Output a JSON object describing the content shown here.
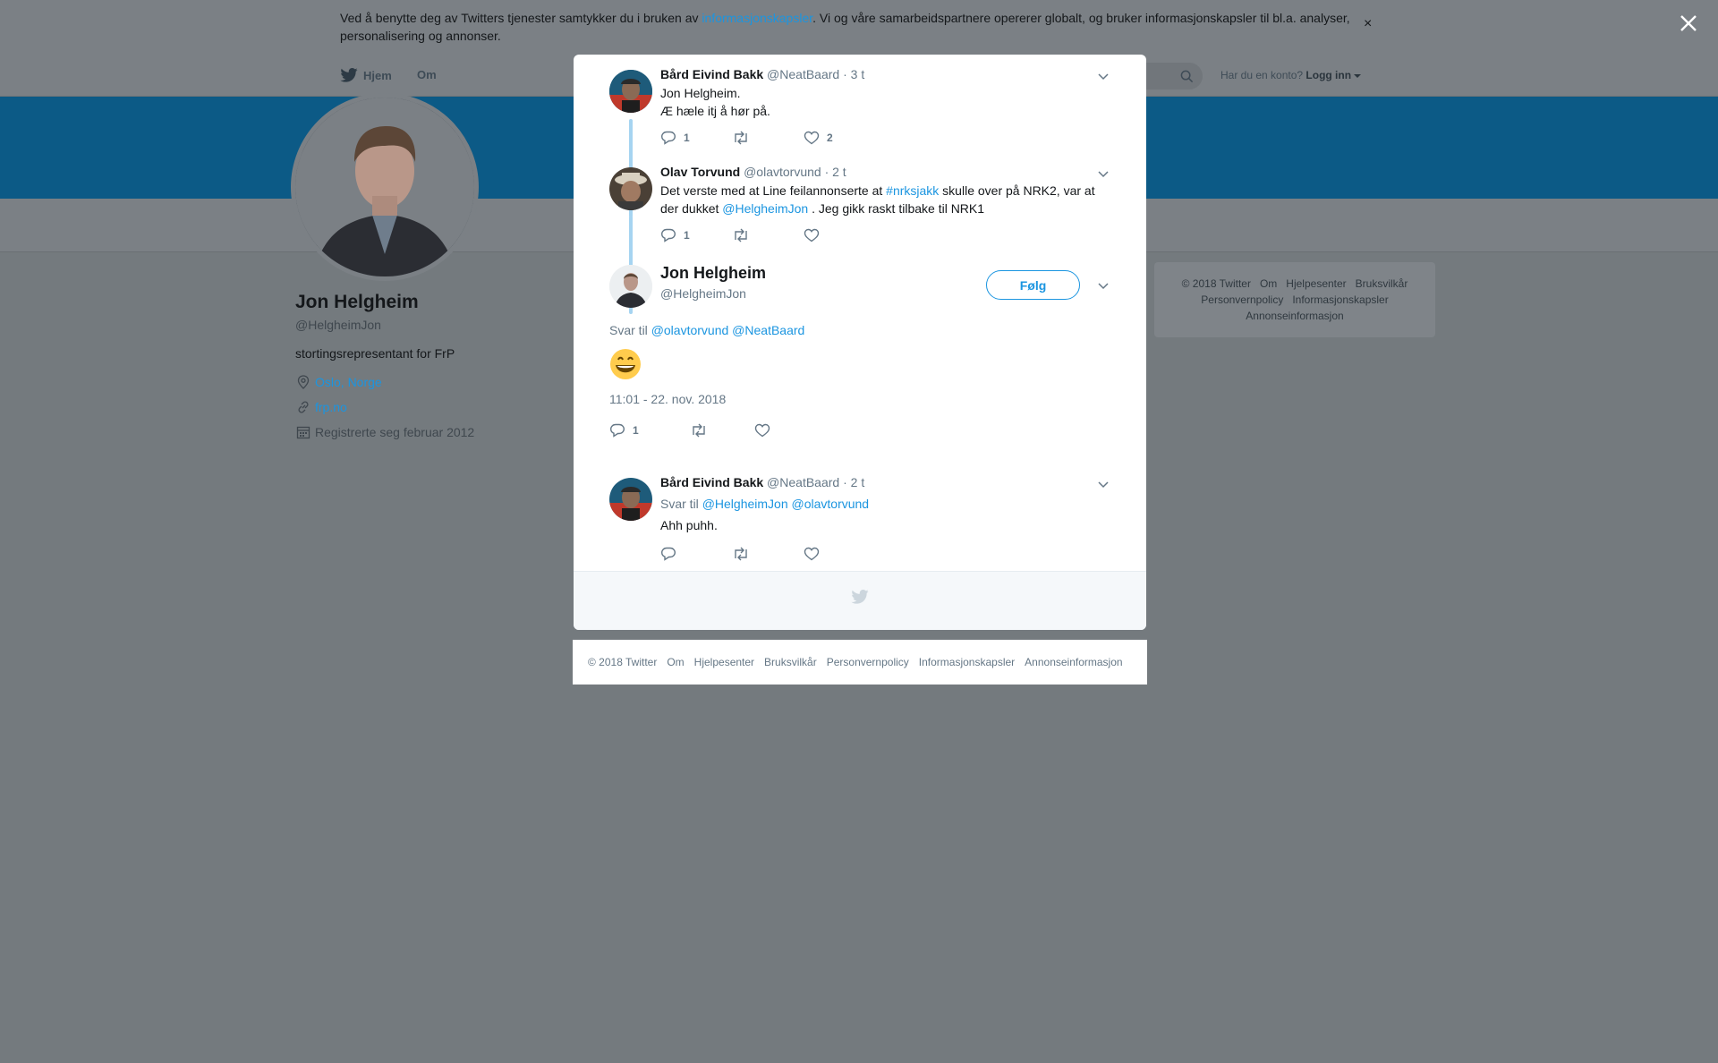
{
  "cookie": {
    "text_before": "Ved å benytte deg av Twitters tjenester samtykker du i bruken av ",
    "link": "informasjonskapsler",
    "text_after": ". Vi og våre samarbeidspartnere opererer globalt, og bruker informasjonskapsler til bl.a. analyser, personalisering og annonser.",
    "close": "×"
  },
  "nav": {
    "home": "Hjem",
    "about": "Om",
    "have_account": "Har du en konto?",
    "login": "Logg inn"
  },
  "profile": {
    "name": "Jon Helgheim",
    "handle": "@HelgheimJon",
    "bio": "stortingsrepresentant for FrP",
    "location": "Oslo, Norge",
    "website": "frp.no",
    "joined": "Registrerte seg februar 2012"
  },
  "side_footer": [
    "© 2018 Twitter",
    "Om",
    "Hjelpesenter",
    "Bruksvilkår",
    "Personvernpolicy",
    "Informasjonskapsler",
    "Annonseinformasjon"
  ],
  "tweets": {
    "t1": {
      "name": "Bård Eivind Bakk",
      "handle": "@NeatBaard",
      "time": "· 3 t",
      "line1": "Jon Helgheim.",
      "line2": "Æ hæle itj å hør på.",
      "replies": "1",
      "likes": "2"
    },
    "t2": {
      "name": "Olav Torvund",
      "handle": "@olavtorvund",
      "time": "· 2 t",
      "text1": "Det verste med at Line feilannonserte at ",
      "hashtag": "#nrksjakk",
      "text2": " skulle over på NRK2, var at der dukket ",
      "mention": "@HelgheimJon",
      "text3": " . Jeg gikk raskt tilbake til NRK1",
      "replies": "1"
    },
    "main": {
      "name": "Jon Helgheim",
      "handle": "@HelgheimJon",
      "follow": "Følg",
      "reply_label": "Svar til ",
      "reply_m1": "@olavtorvund",
      "reply_m2": "@NeatBaard",
      "emoji": "😁",
      "timestamp": "11:01 - 22. nov. 2018",
      "replies": "1"
    },
    "t4": {
      "name": "Bård Eivind Bakk",
      "handle": "@NeatBaard",
      "time": "· 2 t",
      "reply_label": "Svar til ",
      "reply_m1": "@HelgheimJon",
      "reply_m2": "@olavtorvund",
      "text": "Ahh puhh."
    }
  },
  "bottom_footer": [
    "© 2018 Twitter",
    "Om",
    "Hjelpesenter",
    "Bruksvilkår",
    "Personvernpolicy",
    "Informasjonskapsler",
    "Annonseinformasjon"
  ],
  "colors": {
    "link": "#1b95e0",
    "overlay": "#747a7e",
    "banner": "#0c5a86"
  }
}
